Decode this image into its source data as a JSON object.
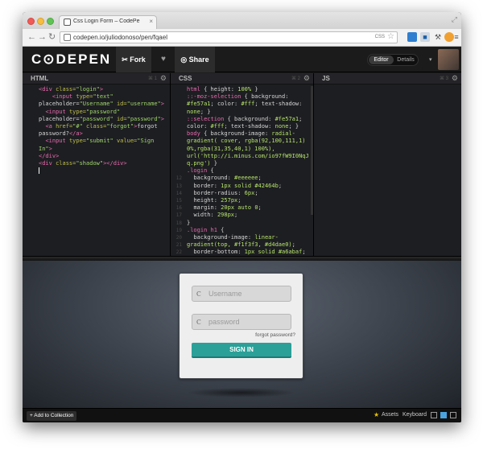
{
  "browser": {
    "tab_title": "Css Login Form – CodePe",
    "tab_close": "×",
    "resize_glyph": "⤢",
    "back": "←",
    "forward": "→",
    "reload": "↻",
    "url": "codepen.io/juliodonoso/pen/fqael",
    "css_badge": "CSS",
    "bookmark_star": "☆",
    "menu_glyph": "≡"
  },
  "header": {
    "logo": "C⊙DEPEN",
    "fork_label": "✂ Fork",
    "heart_glyph": "♥",
    "share_label": "◎ Share",
    "view_editor": "Editor",
    "view_details": "Details",
    "user_caret": "▾"
  },
  "editors": {
    "html": {
      "title": "HTML",
      "shortcut": "⌘ 1",
      "gear": "⚙"
    },
    "css": {
      "title": "CSS",
      "shortcut": "⌘ 2",
      "gear": "⚙"
    },
    "js": {
      "title": "JS",
      "shortcut": "⌘ 3",
      "gear": "⚙"
    },
    "css_gutter": [
      "",
      "",
      "",
      "",
      "",
      "",
      "",
      "",
      "",
      "",
      "",
      "",
      "12",
      "13",
      "14",
      "15",
      "16",
      "17",
      "18",
      "19",
      "20",
      "21",
      "22",
      "23"
    ]
  },
  "result": {
    "username_placeholder": "Username",
    "password_placeholder": "password",
    "key_icon": "Ⲥ",
    "forgot_link": "forgot password?",
    "signin_label": "SIGN IN"
  },
  "footer": {
    "add_to_collection": "+ Add to Collection",
    "star": "★",
    "assets": "Assets",
    "keyboard": "Keyboard"
  }
}
